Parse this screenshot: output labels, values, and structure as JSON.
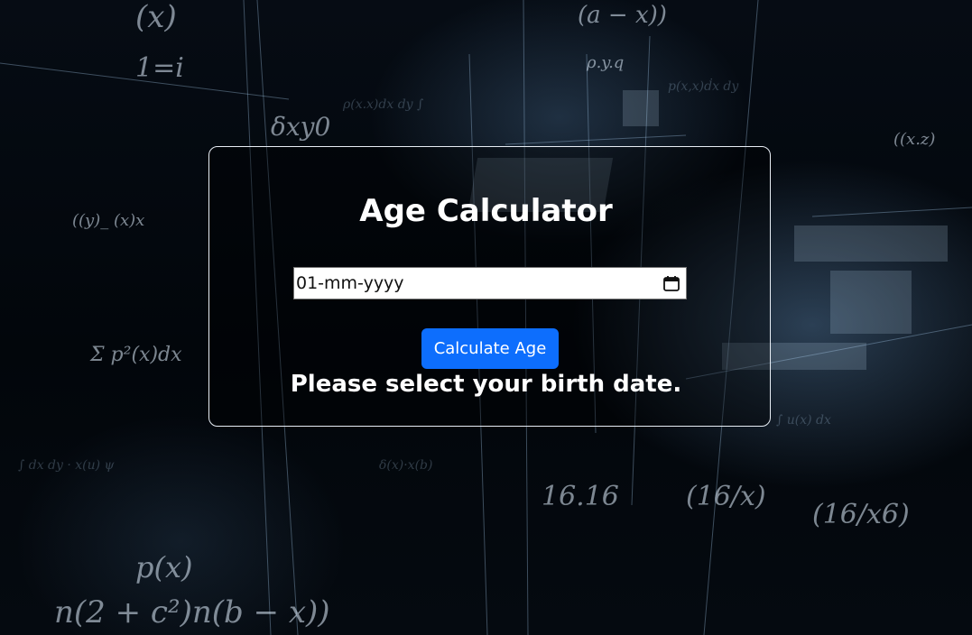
{
  "app": {
    "title": "Age Calculator"
  },
  "date_input": {
    "value": "01-mm-yyyy",
    "icon": "calendar-icon"
  },
  "actions": {
    "calculate_label": "Calculate Age"
  },
  "result": {
    "message": "Please select your birth date."
  },
  "colors": {
    "button": "#0d6efd",
    "text": "#ffffff",
    "panel_border": "#e8eef5",
    "background": "#03070c"
  }
}
